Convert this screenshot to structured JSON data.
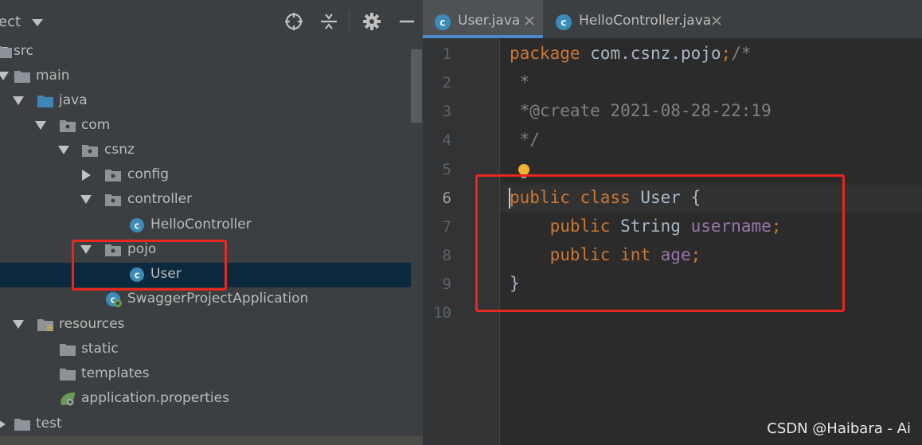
{
  "project_panel": {
    "title": "ect",
    "tree": [
      {
        "label": "src",
        "icon": "folder-icon",
        "expanded": true
      },
      {
        "label": "main",
        "icon": "folder-icon",
        "expanded": true
      },
      {
        "label": "java",
        "icon": "source-folder-icon",
        "expanded": true
      },
      {
        "label": "com",
        "icon": "package-icon",
        "expanded": true
      },
      {
        "label": "csnz",
        "icon": "package-icon",
        "expanded": true
      },
      {
        "label": "config",
        "icon": "package-icon",
        "expanded": false
      },
      {
        "label": "controller",
        "icon": "package-icon",
        "expanded": true
      },
      {
        "label": "HelloController",
        "icon": "class-icon"
      },
      {
        "label": "pojo",
        "icon": "package-icon",
        "expanded": true
      },
      {
        "label": "User",
        "icon": "class-icon",
        "selected": true
      },
      {
        "label": "SwaggerProjectApplication",
        "icon": "spring-boot-class-icon"
      },
      {
        "label": "resources",
        "icon": "resources-folder-icon",
        "expanded": true
      },
      {
        "label": "static",
        "icon": "folder-icon"
      },
      {
        "label": "templates",
        "icon": "folder-icon"
      },
      {
        "label": "application.properties",
        "icon": "spring-properties-icon"
      },
      {
        "label": "test",
        "icon": "folder-icon",
        "expanded": false
      }
    ]
  },
  "editor": {
    "tabs": [
      {
        "label": "User.java",
        "active": true
      },
      {
        "label": "HelloController.java",
        "active": false
      }
    ],
    "line_numbers": [
      "1",
      "2",
      "3",
      "4",
      "5",
      "6",
      "7",
      "8",
      "9",
      "10"
    ],
    "current_line": "6",
    "code": {
      "l1_kw": "package",
      "l1_pkg": " com.csnz.pojo",
      "l1_semi": ";",
      "l1_cm": "/*",
      "l2": " *",
      "l3": " *@create 2021-08-28-22:19",
      "l4": " */",
      "l6_kw1": "public",
      "l6_kw2": " class",
      "l6_rest": " User {",
      "l7_kw": "    public",
      "l7_type": " String",
      "l7_fld": " username",
      "l7_semi": ";",
      "l8_kw": "    public",
      "l8_type": " int",
      "l8_fld": " age",
      "l8_semi": ";",
      "l9": "}"
    }
  },
  "watermark": "CSDN @Haibara - Ai",
  "colors": {
    "panel_bg": "#3c3f41",
    "editor_bg": "#2b2b2b",
    "keyword": "#cc7832",
    "comment": "#808080",
    "field": "#9876aa",
    "annotation_red": "#e8281e",
    "selection": "#0d293e"
  }
}
